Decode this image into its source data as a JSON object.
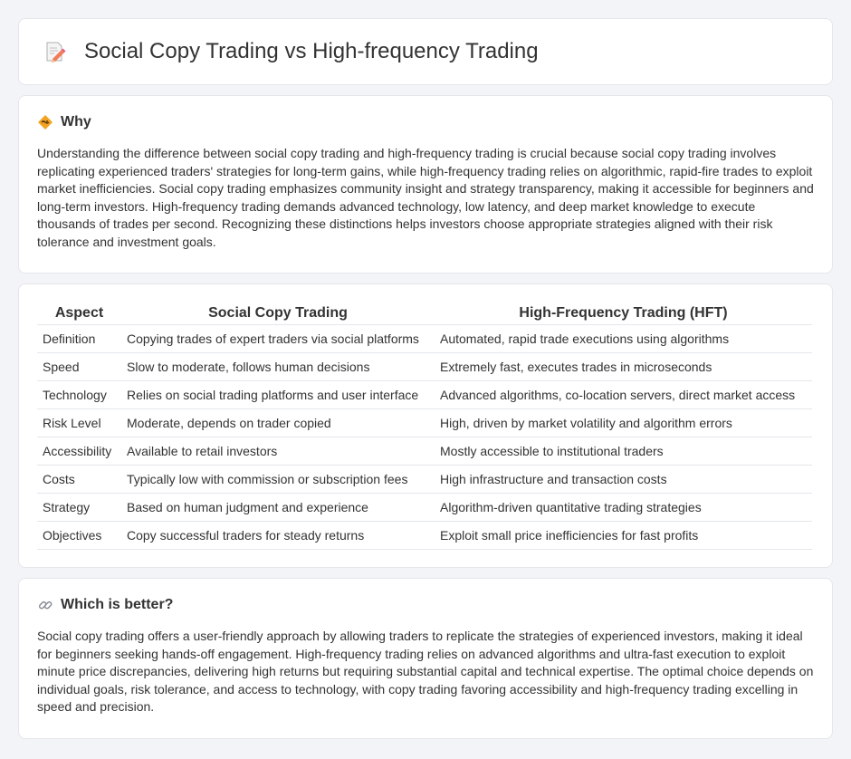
{
  "header": {
    "title": "Social Copy Trading vs High-frequency Trading",
    "icon": "memo-pencil-icon"
  },
  "why": {
    "title": "Why",
    "icon": "handshake-icon",
    "text": "Understanding the difference between social copy trading and high-frequency trading is crucial because social copy trading involves replicating experienced traders' strategies for long-term gains, while high-frequency trading relies on algorithmic, rapid-fire trades to exploit market inefficiencies. Social copy trading emphasizes community insight and strategy transparency, making it accessible for beginners and long-term investors. High-frequency trading demands advanced technology, low latency, and deep market knowledge to execute thousands of trades per second. Recognizing these distinctions helps investors choose appropriate strategies aligned with their risk tolerance and investment goals."
  },
  "table": {
    "headers": [
      "Aspect",
      "Social Copy Trading",
      "High-Frequency Trading (HFT)"
    ],
    "rows": [
      [
        "Definition",
        "Copying trades of expert traders via social platforms",
        "Automated, rapid trade executions using algorithms"
      ],
      [
        "Speed",
        "Slow to moderate, follows human decisions",
        "Extremely fast, executes trades in microseconds"
      ],
      [
        "Technology",
        "Relies on social trading platforms and user interface",
        "Advanced algorithms, co-location servers, direct market access"
      ],
      [
        "Risk Level",
        "Moderate, depends on trader copied",
        "High, driven by market volatility and algorithm errors"
      ],
      [
        "Accessibility",
        "Available to retail investors",
        "Mostly accessible to institutional traders"
      ],
      [
        "Costs",
        "Typically low with commission or subscription fees",
        "High infrastructure and transaction costs"
      ],
      [
        "Strategy",
        "Based on human judgment and experience",
        "Algorithm-driven quantitative trading strategies"
      ],
      [
        "Objectives",
        "Copy successful traders for steady returns",
        "Exploit small price inefficiencies for fast profits"
      ]
    ]
  },
  "better": {
    "title": "Which is better?",
    "icon": "link-icon",
    "text": "Social copy trading offers a user-friendly approach by allowing traders to replicate the strategies of experienced investors, making it ideal for beginners seeking hands-off engagement. High-frequency trading relies on advanced algorithms and ultra-fast execution to exploit minute price discrepancies, delivering high returns but requiring substantial capital and technical expertise. The optimal choice depends on individual goals, risk tolerance, and access to technology, with copy trading favoring accessibility and high-frequency trading excelling in speed and precision."
  }
}
